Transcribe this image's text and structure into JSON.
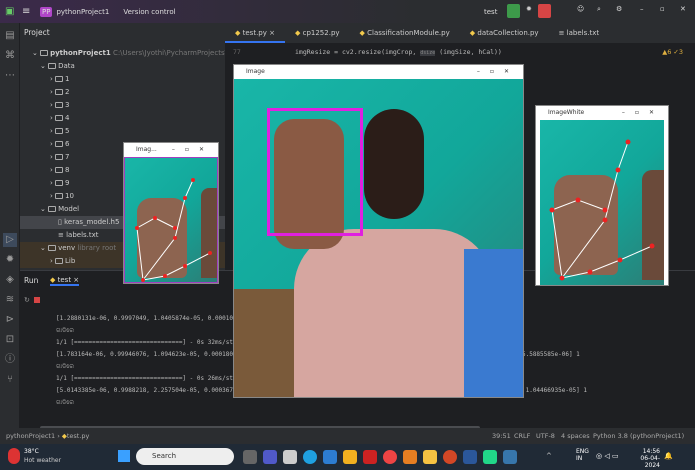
{
  "titlebar": {
    "project": "pythonProject1",
    "project_badge": "PP",
    "vcs": "Version control",
    "run_config": "test"
  },
  "project_panel": {
    "title": "Project",
    "root": "pythonProject1",
    "root_path": "C:\\Users\\Jyothi\\PycharmProjects\\pythonProje",
    "items": [
      "Data",
      "1",
      "2",
      "3",
      "4",
      "5",
      "6",
      "7",
      "8",
      "9",
      "10",
      "Model",
      "keras_model.h5",
      "labels.txt",
      "venv",
      "Lib"
    ],
    "venv_note": "library root"
  },
  "editor": {
    "tabs": [
      "test.py",
      "cp1252.py",
      "ClassificationModule.py",
      "dataCollection.py",
      "labels.txt"
    ],
    "line_no": "77",
    "code_line": "imgResize = cv2.resize(imgCrop,",
    "hint": "dsize",
    "code_rest": "(imgSize, hCal))",
    "inspections": "▲6 ✓3"
  },
  "windows": {
    "image": "Image",
    "small": "Imag...",
    "white": "ImageWhite"
  },
  "run": {
    "label": "Run",
    "tab": "test",
    "lines": [
      "[1.2880131e-06, 0.9997049, 1.0405874e-05, 0.00010786277 ... 3864e-06] 1",
      "ଗାଡିରେ",
      "1/1 [==============================] - 0s 32ms/step",
      "[1.783164e-06, 0.99946076, 1.094623e-05, 0.00018026374, 4.873343e-05, 2.1988973e-05, 0.00025141105, 8.0085664e-07, 1.767585e-05, 5.5885585e-06] 1",
      "ଗାଡିରେ",
      "1/1 [==============================] - 0s 26ms/step",
      "[5.0143385e-06, 0.9988218, 2.257504e-05, 0.00036727588, 0.00013002739, 6.175455e-05, 0.00050121755, 2.5495833e-06, 7.7351855e-05, 1.04466935e-05] 1",
      "ଗାଡିରେ"
    ]
  },
  "status": {
    "breadcrumb_project": "pythonProject1",
    "breadcrumb_file": "test.py",
    "position": "39:51",
    "line_sep": "CRLF",
    "encoding": "UTF-8",
    "indent": "4 spaces",
    "interpreter": "Python 3.8 (pythonProject1)"
  },
  "taskbar": {
    "temp": "38°C",
    "weather": "Hot weather",
    "search": "Search",
    "lang1": "ENG",
    "lang2": "IN",
    "time": "14:56",
    "date": "06-04-2024"
  }
}
